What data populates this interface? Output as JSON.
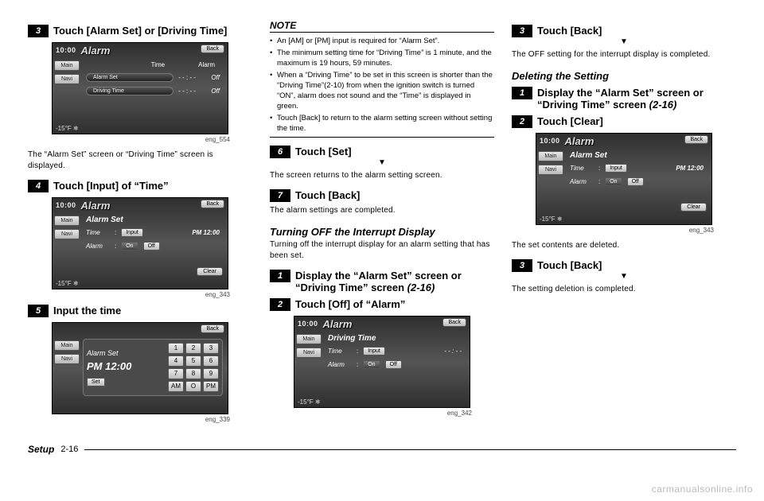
{
  "col1": {
    "s3": "Touch [Alarm Set] or [Driving Time]",
    "cap_a": "eng_554",
    "after_a": "The “Alarm Set” screen or “Driving Time” screen is displayed.",
    "s4": "Touch [Input] of “Time”",
    "cap_b": "eng_343",
    "s5": "Input the time",
    "cap_c": "eng_339"
  },
  "col2": {
    "note_head": "NOTE",
    "note_items": [
      "An [AM] or [PM] input is required for “Alarm Set”.",
      "The minimum setting time for “Driving Time” is 1 minute, and the maximum is 19 hours, 59 minutes.",
      "When a “Driving Time” to be set in this screen is shorter than the “Driving Time”(2-10) from when the ignition switch is turned “ON”, alarm does not sound and the “Time” is displayed in green.",
      "Touch [Back] to return to the alarm setting screen without setting the time."
    ],
    "s6": "Touch [Set]",
    "after6": "The screen returns to the alarm setting screen.",
    "s7": "Touch [Back]",
    "after7": "The alarm settings are completed.",
    "sub1": "Turning OFF the Interrupt Display",
    "sub1_body": "Turning off the interrupt display for an alarm setting that has been set.",
    "s1b": "Display the “Alarm Set” screen or “Driving Time” screen ",
    "s1b_ref": "(2-16)",
    "s2b": "Touch [Off] of “Alarm”",
    "cap_d": "eng_342"
  },
  "col3": {
    "s3c": "Touch [Back]",
    "after3c": "The OFF setting for the interrupt display is completed.",
    "sub2": "Deleting the Setting",
    "s1c": "Display the “Alarm Set” screen or “Driving Time” screen ",
    "s1c_ref": "(2-16)",
    "s2c": "Touch [Clear]",
    "cap_e": "eng_343",
    "after_e": "The set contents are deleted.",
    "s3d": "Touch [Back]",
    "after3d": "The setting deletion is completed."
  },
  "shot": {
    "clock": "10:00",
    "title_alarm": "Alarm",
    "title_set": "Alarm Set",
    "title_drive": "Driving Time",
    "back": "Back",
    "main": "Main",
    "navi": "Navi",
    "temp": "-15°F ❄",
    "time_label": "Time",
    "alarm_label": "Alarm",
    "alarm_set_pill": "Alarm Set",
    "driving_pill": "Driving Time",
    "dashes": "- - : - -",
    "off": "Off",
    "input": "Input",
    "pm1200": "PM 12:00",
    "on": "On",
    "clear": "Clear",
    "set": "Set",
    "am": "AM",
    "o": "O",
    "pm": "PM",
    "keys": [
      "1",
      "2",
      "3",
      "4",
      "5",
      "6",
      "7",
      "8",
      "9"
    ]
  },
  "footer": {
    "section": "Setup",
    "page": "2-16"
  },
  "watermark": "carmanualsonline.info"
}
